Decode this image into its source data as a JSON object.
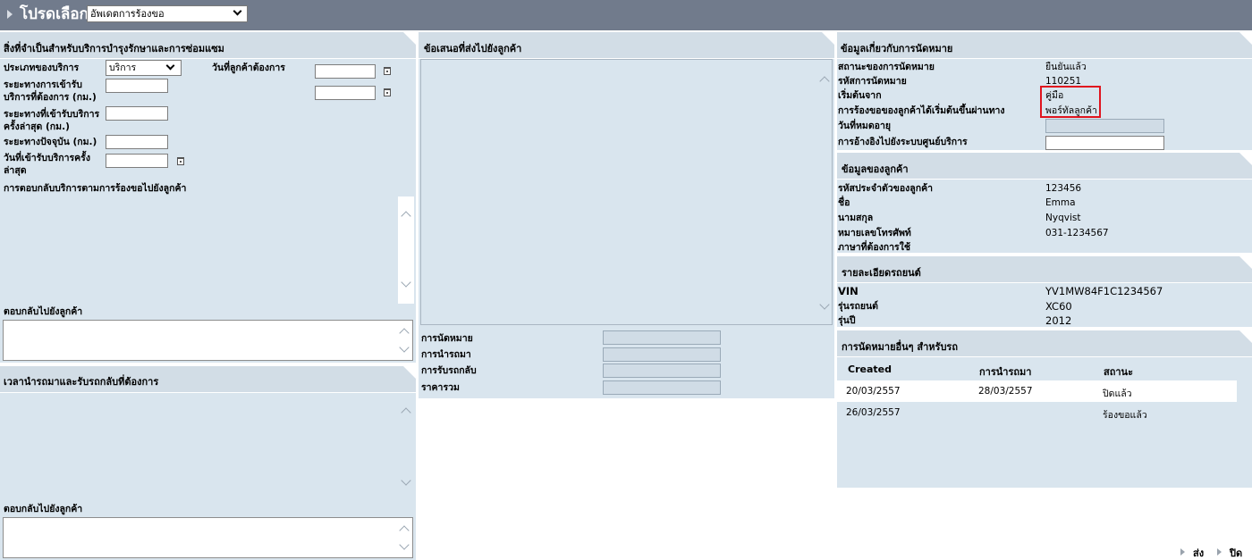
{
  "topbar": {
    "title": "โปรดเลือก",
    "action_select": "อัพเดตการร้องขอ"
  },
  "service_panel": {
    "title": "สิ่งที่จำเป็นสำหรับบริการบำรุงรักษาและการซ่อมแซม",
    "service_type_label": "ประเภทของบริการ",
    "service_type_value": "บริการ",
    "requested_date_label": "วันที่ลูกค้าต้องการ",
    "distance_required_label": "ระยะทางการเข้ารับบริการที่ต้องการ (กม.)",
    "distance_last_label": "ระยะทางที่เข้ารับบริการครั้งล่าสุด (กม.)",
    "distance_current_label": "ระยะทางปัจจุบัน (กม.)",
    "last_service_date_label": "วันที่เข้ารับบริการครั้งล่าสุด",
    "response_label": "การตอบกลับบริการตามการร้องขอไปยังลูกค้า",
    "reply_label": "ตอบกลับไปยังลูกค้า"
  },
  "transport_panel": {
    "title": "เวลานำรถมาและรับรถกลับที่ต้องการ",
    "reply_label": "ตอบกลับไปยังลูกค้า"
  },
  "offer_panel": {
    "title": "ข้อเสนอที่ส่งไปยังลูกค้า",
    "fields": [
      {
        "label": "การนัดหมาย"
      },
      {
        "label": "การนำรถมา"
      },
      {
        "label": "การรับรถกลับ"
      },
      {
        "label": "ราคารวม"
      }
    ]
  },
  "appointment_info": {
    "title": "ข้อมูลเกี่ยวกับการนัดหมาย",
    "status_label": "สถานะของการนัดหมาย",
    "status_value": "ยืนยันแล้ว",
    "code_label": "รหัสการนัดหมาย",
    "code_value": "110251",
    "origin_label": "เริ่มต้นจาก",
    "origin_value": "คู่มือ",
    "channel_label": "การร้องขอของลูกค้าได้เริ่มต้นขึ้นผ่านทาง",
    "channel_value": "พอร์ทัลลูกค้า",
    "expiry_label": "วันที่หมดอายุ",
    "reference_label": "การอ้างอิงไปยังระบบศูนย์บริการ"
  },
  "customer_info": {
    "title": "ข้อมูลของลูกค้า",
    "id_label": "รหัสประจำตัวของลูกค้า",
    "id_value": "123456",
    "first_name_label": "ชื่อ",
    "first_name_value": "Emma",
    "last_name_label": "นามสกุล",
    "last_name_value": "Nyqvist",
    "phone_label": "หมายเลขโทรศัพท์",
    "phone_value": "031-1234567",
    "language_label": "ภาษาที่ต้องการใช้"
  },
  "vehicle_info": {
    "title": "รายละเอียดรถยนต์",
    "vin_label": "VIN",
    "vin_value": "YV1MW84F1C1234567",
    "model_label": "รุ่นรถยนต์",
    "model_value": "XC60",
    "year_label": "รุ่นปี",
    "year_value": "2012"
  },
  "other_appointments": {
    "title": "การนัดหมายอื่นๆ สำหรับรถ",
    "columns": [
      "Created",
      "การนำรถมา",
      "สถานะ"
    ],
    "rows": [
      [
        "20/03/2557",
        "28/03/2557",
        "ปิดแล้ว"
      ],
      [
        "26/03/2557",
        "",
        "ร้องขอแล้ว"
      ]
    ]
  },
  "footer": {
    "send_label": "ส่ง",
    "close_label": "ปิด"
  }
}
